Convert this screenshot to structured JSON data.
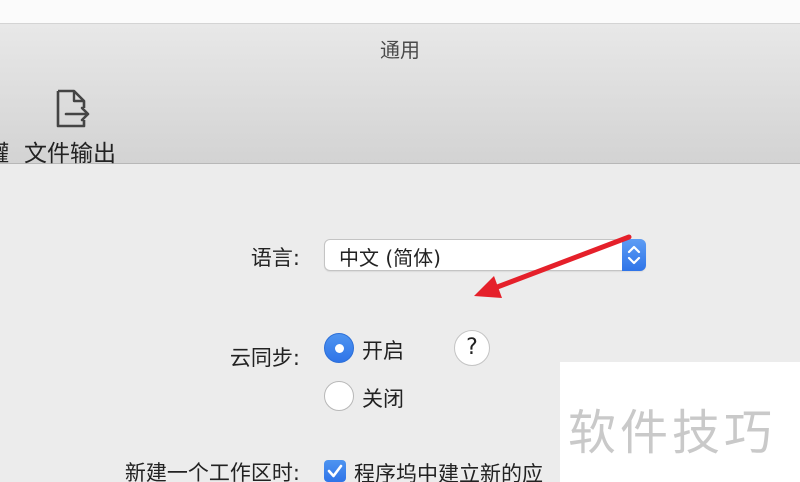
{
  "window": {
    "title": "通用"
  },
  "toolbar": {
    "cut_label": "罐",
    "export_label": "文件输出",
    "export_icon": "file-export-icon"
  },
  "settings": {
    "language": {
      "label": "语言:",
      "value": "中文 (简体)"
    },
    "cloud_sync": {
      "label": "云同步:",
      "options": [
        "开启",
        "关闭"
      ],
      "selected": "开启",
      "help": "?"
    },
    "new_workspace": {
      "label": "新建一个工作区时:",
      "checkbox_label": "程序坞中建立新的应",
      "checked": true
    }
  },
  "watermark": {
    "text": "软件技巧"
  },
  "colors": {
    "accent": "#2f74e8",
    "annotation_arrow": "#e5202a"
  }
}
